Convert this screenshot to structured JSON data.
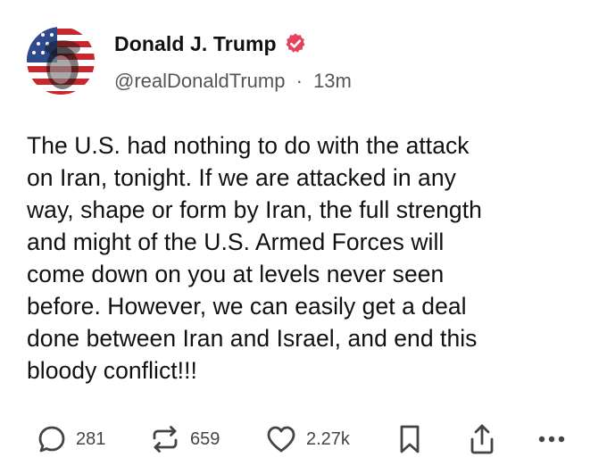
{
  "author": {
    "display_name": "Donald J. Trump",
    "handle": "@realDonaldTrump",
    "separator": "·",
    "time_ago": "13m",
    "verified_icon": "verified-badge-icon",
    "verified_color": "#e5435d"
  },
  "post": {
    "lines": [
      "The U.S. had nothing to do with the attack",
      "on Iran, tonight. If we are attacked in any",
      "way, shape or form by Iran, the full strength",
      "and might of the U.S. Armed Forces will",
      "come down on you at levels never seen",
      "before. However, we can easily get a deal",
      "done between Iran and Israel, and end this",
      "bloody conflict!!!"
    ]
  },
  "actions": {
    "replies": {
      "icon": "reply-icon",
      "count": "281"
    },
    "retruths": {
      "icon": "retruth-icon",
      "count": "659"
    },
    "likes": {
      "icon": "heart-icon",
      "count": "2.27k"
    },
    "bookmark": {
      "icon": "bookmark-icon"
    },
    "share": {
      "icon": "share-icon"
    },
    "more": {
      "icon": "more-icon"
    }
  },
  "colors": {
    "text": "#111111",
    "muted": "#555555",
    "icon": "#444444"
  }
}
